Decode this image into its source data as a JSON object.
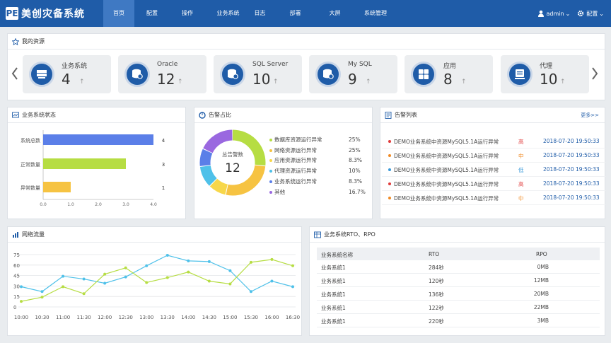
{
  "brand": {
    "logo_mark": "PE",
    "title": "美创灾备系统"
  },
  "nav": [
    {
      "label": "首页",
      "active": true
    },
    {
      "label": "配置",
      "active": false
    },
    {
      "label": "操作",
      "active": false
    },
    {
      "label": "业务系统",
      "active": false
    },
    {
      "label": "日志",
      "active": false
    },
    {
      "label": "部署",
      "active": false
    },
    {
      "label": "大屏",
      "active": false
    },
    {
      "label": "系统管理",
      "active": false
    }
  ],
  "user": {
    "name": "admin",
    "settings_label": "配置"
  },
  "resources": {
    "title": "我的资源",
    "cards": [
      {
        "label": "业务系统",
        "count": "4",
        "trend": "↑",
        "icon": "server-stack-icon"
      },
      {
        "label": "Oracle",
        "count": "12",
        "trend": "↑",
        "icon": "database-icon"
      },
      {
        "label": "SQL Server",
        "count": "10",
        "trend": "↑",
        "icon": "database-icon"
      },
      {
        "label": "My SQL",
        "count": "9",
        "trend": "↑",
        "icon": "database-icon"
      },
      {
        "label": "应用",
        "count": "8",
        "trend": "↑",
        "icon": "grid-apps-icon"
      },
      {
        "label": "代理",
        "count": "10",
        "trend": "↑",
        "icon": "agent-icon"
      }
    ]
  },
  "status_panel": {
    "title": "业务系统状态",
    "chart_data": {
      "type": "bar",
      "orientation": "horizontal",
      "categories": [
        "系统总数",
        "正常数量",
        "异常数量"
      ],
      "values": [
        4,
        3,
        1
      ],
      "colors": [
        "#5b7fe8",
        "#b6dd43",
        "#f6c342"
      ],
      "xlim": [
        0,
        4
      ],
      "xticks": [
        "0.0",
        "1.0",
        "2.0",
        "3.0",
        "4.0"
      ]
    }
  },
  "alarm_ratio": {
    "title": "告警占比",
    "center_label": "总告警数",
    "center_value": "12",
    "chart_data": {
      "type": "pie",
      "variant": "donut",
      "labels": [
        "数据库资源运行异常",
        "网络资源运行异常",
        "应用资源运行异常",
        "代理资源运行异常",
        "业务系统运行异常",
        "其他"
      ],
      "display_values": [
        "25%",
        "25%",
        "8.3%",
        "10%",
        "8.3%",
        "16.7%"
      ],
      "values": [
        25,
        25,
        8.3,
        10,
        8.3,
        16.7
      ],
      "colors": [
        "#b6dd43",
        "#f6c342",
        "#f7d74a",
        "#4fc1e9",
        "#5b7fe8",
        "#9a68e0"
      ]
    }
  },
  "alarm_list": {
    "title": "告警列表",
    "more_label": "更多>>",
    "items": [
      {
        "message": "DEMO业务系统中资源MySQL5.1A运行异常",
        "level": "高",
        "level_color": "#e03c3c",
        "time": "2018-07-20 19:50:33"
      },
      {
        "message": "DEMO业务系统中资源MySQL5.1A运行异常",
        "level": "中",
        "level_color": "#f08a24",
        "time": "2018-07-20 19:50:33"
      },
      {
        "message": "DEMO业务系统中资源MySQL5.1A运行异常",
        "level": "低",
        "level_color": "#3a9ad9",
        "time": "2018-07-20 19:50:33"
      },
      {
        "message": "DEMO业务系统中资源MySQL5.1A运行异常",
        "level": "高",
        "level_color": "#e03c3c",
        "time": "2018-07-20 19:50:33"
      },
      {
        "message": "DEMO业务系统中资源MySQL5.1A运行异常",
        "level": "中",
        "level_color": "#f08a24",
        "time": "2018-07-20 19:50:33"
      }
    ]
  },
  "network": {
    "title": "网络流量",
    "chart_data": {
      "type": "line",
      "x": [
        "10:00",
        "10:30",
        "11:00",
        "11:30",
        "12:00",
        "12:30",
        "13:00",
        "13:30",
        "14:00",
        "14:30",
        "15:00",
        "15:30",
        "16:00",
        "16:30"
      ],
      "ylim": [
        0,
        75
      ],
      "yticks": [
        "0",
        "15",
        "30",
        "45",
        "60",
        "75"
      ],
      "series": [
        {
          "color": "#4fc1e9",
          "values": [
            29,
            22,
            44,
            40,
            34,
            43,
            59,
            74,
            66,
            65,
            52,
            22,
            37,
            29
          ]
        },
        {
          "color": "#b6dd43",
          "values": [
            8,
            14,
            29,
            19,
            47,
            56,
            35,
            42,
            50,
            37,
            33,
            64,
            68,
            59
          ]
        }
      ]
    }
  },
  "rto": {
    "title": "业务系统RTO、RPO",
    "headers": [
      "业务系统名称",
      "RTO",
      "RPO"
    ],
    "rows": [
      [
        "业务系统1",
        "284秒",
        "0MB"
      ],
      [
        "业务系统1",
        "120秒",
        "12MB"
      ],
      [
        "业务系统1",
        "136秒",
        "20MB"
      ],
      [
        "业务系统1",
        "122秒",
        "22MB"
      ],
      [
        "业务系统1",
        "220秒",
        "3MB"
      ]
    ]
  }
}
